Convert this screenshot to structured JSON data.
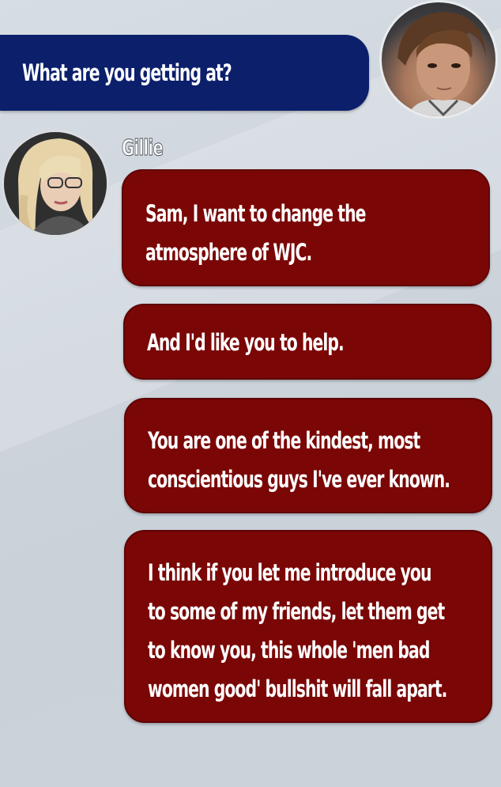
{
  "player": {
    "message": "What are you getting at?"
  },
  "npc": {
    "name": "Gillie",
    "messages": [
      [
        "Sam, I want to change the",
        "atmosphere of WJC."
      ],
      [
        "And I'd like you to help."
      ],
      [
        "You are one of the kindest, most",
        "conscientious guys I've ever known."
      ],
      [
        "I think if you let me introduce you",
        "to some of my friends, let them get",
        "to know you, this whole 'men bad",
        "women good' bullshit will fall apart."
      ]
    ]
  },
  "colors": {
    "player_bubble": "#0b1f6b",
    "npc_bubble": "#7a0606",
    "background": "#cdd4dc"
  }
}
